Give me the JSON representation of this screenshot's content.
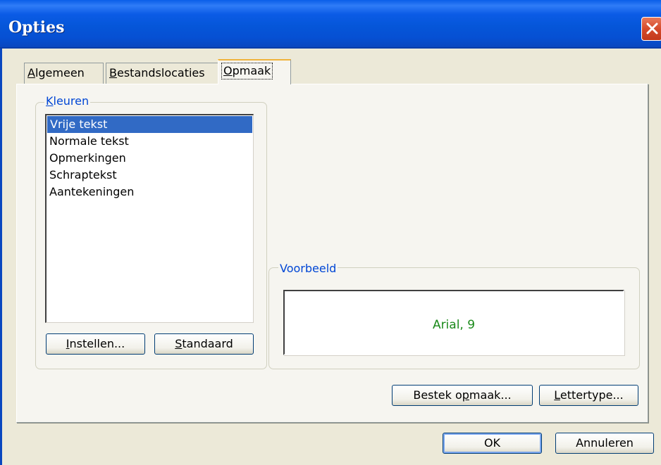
{
  "window": {
    "title": "Opties",
    "close_label": "×"
  },
  "tabs": [
    {
      "label_pre": "",
      "label_ul": "A",
      "label_post": "lgemeen",
      "selected": false
    },
    {
      "label_pre": "",
      "label_ul": "B",
      "label_post": "estandslocaties",
      "selected": false
    },
    {
      "label_pre": "",
      "label_ul": "O",
      "label_post": "pmaak",
      "selected": true
    }
  ],
  "colors_group": {
    "legend_ul": "K",
    "legend_post": "leuren",
    "items": [
      "Vrije tekst",
      "Normale tekst",
      "Opmerkingen",
      "Schraptekst",
      "Aantekeningen"
    ],
    "selected_index": 0,
    "set_button": {
      "ul": "I",
      "post": "nstellen..."
    },
    "default_button": {
      "ul": "S",
      "post": "tandaard"
    }
  },
  "preview_group": {
    "legend": "Voorbeeld",
    "sample_text": "Arial, 9",
    "sample_color": "#1a8a1a"
  },
  "format_buttons": {
    "bestek": {
      "pre": "Bestek o",
      "ul": "p",
      "post": "maak..."
    },
    "font": {
      "ul": "L",
      "post": "ettertype..."
    }
  },
  "dialog_buttons": {
    "ok": "OK",
    "cancel": "Annuleren"
  },
  "colors": {
    "titlebar": "#0556d9",
    "selection": "#316ac5",
    "legend": "#0046d5"
  }
}
